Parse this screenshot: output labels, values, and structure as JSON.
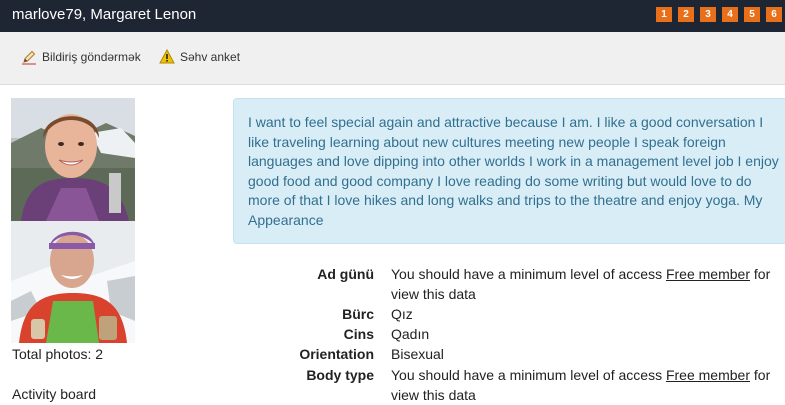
{
  "header": {
    "title": "marlove79, Margaret Lenon",
    "pages": [
      "1",
      "2",
      "3",
      "4",
      "5",
      "6"
    ]
  },
  "toolbar": {
    "send_notification": "Bildiriş göndərmək",
    "wrong_profile": "Səhv anket"
  },
  "sidebar": {
    "total_photos": "Total photos: 2",
    "activity_board": "Activity board"
  },
  "about_text": "I want to feel special again and attractive because I am. I like a good conversation I like traveling learning about new cultures meeting new people I speak foreign languages and love dipping into other worlds I work in a management level job I enjoy good food and good company I love reading do some writing but would love to do more of that I love hikes and long walks and trips to the theatre and enjoy yoga. My Appearance",
  "properties": {
    "birthday": {
      "label": "Ad günü",
      "value_prefix": "You should have a minimum level of access ",
      "value_link": "Free member",
      "value_suffix": " for view this data"
    },
    "zodiac": {
      "label": "Bürc",
      "value": "Qız"
    },
    "gender": {
      "label": "Cins",
      "value": "Qadın"
    },
    "orientation": {
      "label": "Orientation",
      "value": "Bisexual"
    },
    "body_type": {
      "label": "Body type",
      "value_prefix": "You should have a minimum level of access ",
      "value_link": "Free member",
      "value_suffix": " for view this data"
    }
  },
  "colors": {
    "topbar": "#1e2533",
    "pager": "#e8701a",
    "info_bg": "#d9edf7",
    "info_text": "#31708f"
  },
  "icons": {
    "send_notification": "pencil-icon",
    "wrong_profile": "warning-icon"
  }
}
